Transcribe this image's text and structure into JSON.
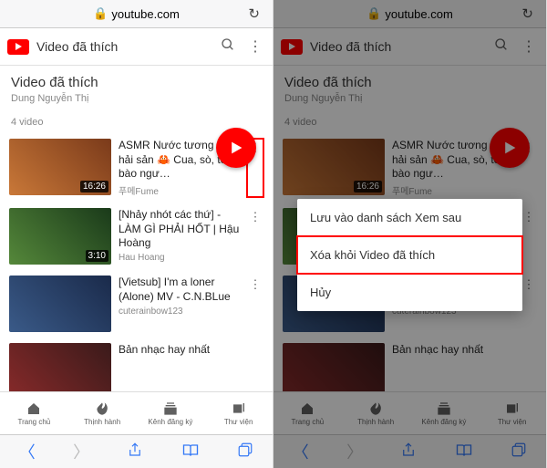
{
  "url_host": "youtube.com",
  "header_title": "Video đã thích",
  "playlist": {
    "title": "Video đã thích",
    "owner": "Dung Nguyễn Thị",
    "count_label": "4 video"
  },
  "videos": [
    {
      "title": "ASMR Nước tương ướp hải sản 🦀 Cua, sò, tôm, bào ngư…",
      "channel": "푸메Fume",
      "duration": "16:26"
    },
    {
      "title": "[Nhảy nhót các thứ] - LÀM GÌ PHẢI HỐT | Hậu Hoàng",
      "channel": "Hau Hoang",
      "duration": "3:10"
    },
    {
      "title": "[Vietsub] I'm a loner (Alone) MV - C.N.BLue",
      "channel": "cuterainbow123",
      "duration": ""
    },
    {
      "title": "Bản nhạc hay nhất",
      "channel": "",
      "duration": ""
    }
  ],
  "nav": [
    "Trang chủ",
    "Thịnh hành",
    "Kênh đăng ký",
    "Thư viện"
  ],
  "menu": {
    "save": "Lưu vào danh sách Xem sau",
    "remove": "Xóa khỏi Video đã thích",
    "cancel": "Hủy"
  }
}
